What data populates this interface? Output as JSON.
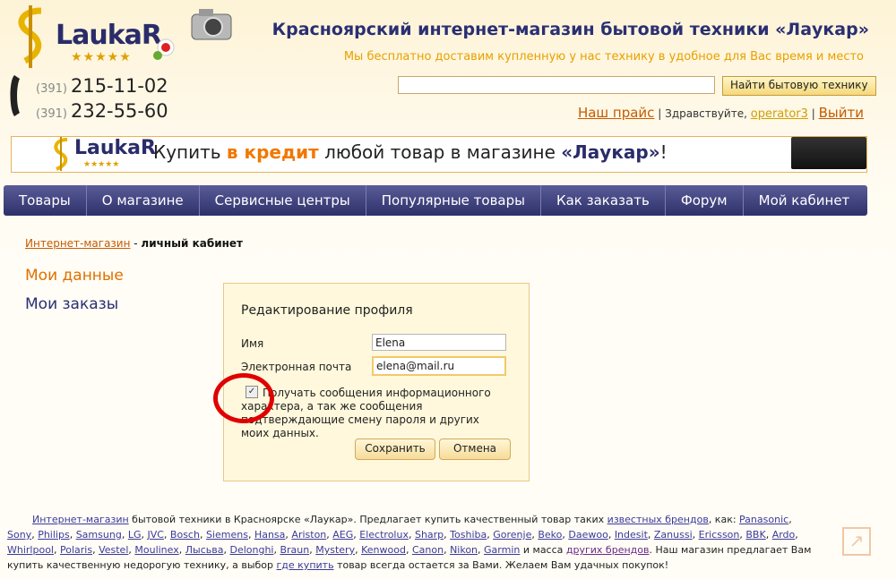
{
  "header": {
    "logo_text": "LaukaR",
    "logo_stars": "★★★★★",
    "title": "Красноярский интернет-магазин бытовой техники «Лаукар»",
    "subtitle": "Мы бесплатно доставим купленную у нас технику в удобное для Вас время и место"
  },
  "phones": [
    {
      "code": "(391)",
      "number": "215-11-02"
    },
    {
      "code": "(391)",
      "number": "232-55-60"
    }
  ],
  "search": {
    "value": "",
    "button_label": "Найти бытовую технику"
  },
  "userbar": {
    "price_link": "Наш прайс",
    "sep1": "|",
    "greeting": "Здравствуйте,",
    "username": "operator3",
    "sep2": "|",
    "logout": "Выйти"
  },
  "banner": {
    "logo_text": "LaukaR",
    "stars": "★★★★★",
    "text_before": "Купить ",
    "text_highlight": "в кредит",
    "text_middle": " любой товар в магазине ",
    "text_brand": "«Лаукар»",
    "text_end": "!"
  },
  "nav": [
    "Товары",
    "О магазине",
    "Сервисные центры",
    "Популярные товары",
    "Как заказать",
    "Форум",
    "Мой кабинет"
  ],
  "breadcrumb": {
    "link": "Интернет-магазин",
    "sep": " - ",
    "current": "личный кабинет"
  },
  "sidebar": {
    "my_data": "Мои данные",
    "my_orders": "Мои заказы"
  },
  "profile": {
    "title": "Редактирование профиля",
    "name_label": "Имя",
    "name_value": "Elena",
    "email_label": "Электронная почта",
    "email_value": "elena@mail.ru",
    "subscribe_checked": true,
    "subscribe_text": "Получать сообщения информационного характера, а так же сообщения подтверждающие смену пароля и других моих данных.",
    "save_label": "Сохранить",
    "cancel_label": "Отмена"
  },
  "footer": {
    "shop_link": "Интернет-магазин",
    "text1": " бытовой техники в Красноярске «Лаукар». Предлагает купить качественный товар таких ",
    "brands_link": "известных брендов",
    "text2": ", как: ",
    "brands": [
      "Panasonic",
      "Sony",
      "Philips",
      "Samsung",
      "LG",
      "JVC",
      "Bosch",
      "Siemens",
      "Hansa",
      "Ariston",
      "AEG",
      "Electrolux",
      "Sharp",
      "Toshiba",
      "Gorenje",
      "Beko",
      "Daewoo",
      "Indesit",
      "Zanussi",
      "Ericsson",
      "BBK",
      "Ardo",
      "Whirlpool",
      "Polaris",
      "Vestel",
      "Moulinex",
      "Лысьва",
      "Delonghi",
      "Braun",
      "Mystery",
      "Kenwood",
      "Canon",
      "Nikon",
      "Garmin"
    ],
    "text3": " и масса ",
    "other_brands_link": "других брендов",
    "text4": ". Наш магазин предлагает Вам купить качественную недорогую технику, а выбор ",
    "where_link": "где купить",
    "text5": " товар всегда остается за Вами. Желаем Вам удачных покупок!"
  },
  "colors": {
    "accent_orange": "#e07000",
    "nav_blue": "#2e306a",
    "link_blue": "#3a3a9a"
  }
}
